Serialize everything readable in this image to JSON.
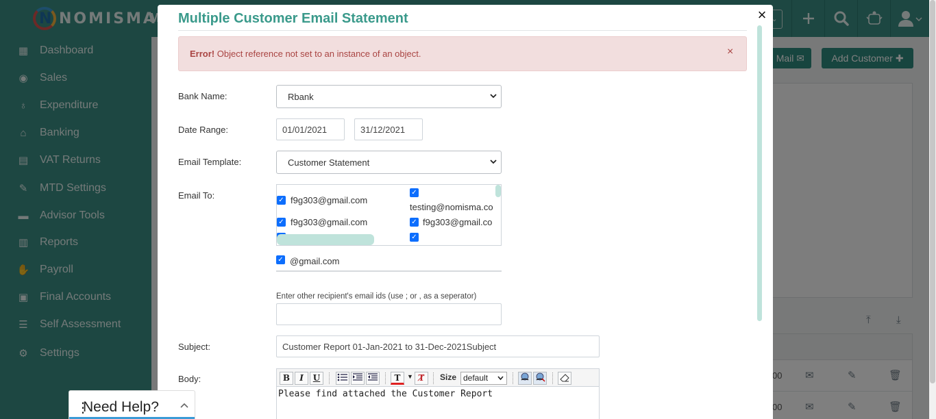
{
  "app": {
    "logo_text": "NOMISMA",
    "logo_mark": "N",
    "menu_fragment": "M"
  },
  "topbar": {
    "select_chevron": "⌄",
    "icons": [
      "plus-icon",
      "search-icon",
      "crest-icon",
      "user-icon"
    ]
  },
  "sidebar": {
    "items": [
      {
        "label": "Dashboard",
        "icon": "dashboard-icon"
      },
      {
        "label": "Sales",
        "icon": "sales-icon"
      },
      {
        "label": "Expenditure",
        "icon": "money-bag-icon"
      },
      {
        "label": "Banking",
        "icon": "bank-icon"
      },
      {
        "label": "VAT Returns",
        "icon": "vat-icon"
      },
      {
        "label": "MTD Settings",
        "icon": "mtd-icon"
      },
      {
        "label": "Advisor Tools",
        "icon": "briefcase-icon"
      },
      {
        "label": "Reports",
        "icon": "reports-icon"
      },
      {
        "label": "Payroll",
        "icon": "payroll-icon"
      },
      {
        "label": "Final Accounts",
        "icon": "final-accounts-icon"
      },
      {
        "label": "Self Assessment",
        "icon": "self-assessment-icon"
      },
      {
        "label": "Settings",
        "icon": "gear-icon"
      }
    ]
  },
  "content": {
    "mail_button": "Mail",
    "add_customer_button": "Add Customer",
    "row_fragment_1": "00",
    "row_fragment_2": "00"
  },
  "modal": {
    "title": "Multiple Customer Email Statement",
    "close_glyph": "×",
    "alert": {
      "strong": "Error!",
      "message": " Object reference not set to an instance of an object.",
      "close_glyph": "×"
    },
    "bank": {
      "label": "Bank Name:",
      "value": "Rbank"
    },
    "date_range": {
      "label": "Date Range:",
      "from": "01/01/2021",
      "to": "31/12/2021"
    },
    "template": {
      "label": "Email Template:",
      "value": "Customer Statement"
    },
    "email_to": {
      "label": "Email To:",
      "left_items": [
        "f9g303@gmail.com",
        "f9g303@gmail.com"
      ],
      "right_items": [
        "testing@nomisma.co",
        "f9g303@gmail.co"
      ],
      "extra_item": "@gmail.com"
    },
    "other_recipients": {
      "hint": "Enter other recipient's email ids (use ; or , as a seperator)",
      "value": ""
    },
    "subject": {
      "label": "Subject:",
      "value": "Customer Report 01-Jan-2021 to 31-Dec-2021Subject"
    },
    "body": {
      "label": "Body:",
      "toolbar": {
        "bold": "B",
        "italic": "I",
        "underline": "U",
        "size_label": "Size",
        "size_value": "default"
      },
      "value": "Please find attached the Customer Report"
    }
  },
  "help": {
    "label": "Need Help?",
    "chevron": "^"
  }
}
